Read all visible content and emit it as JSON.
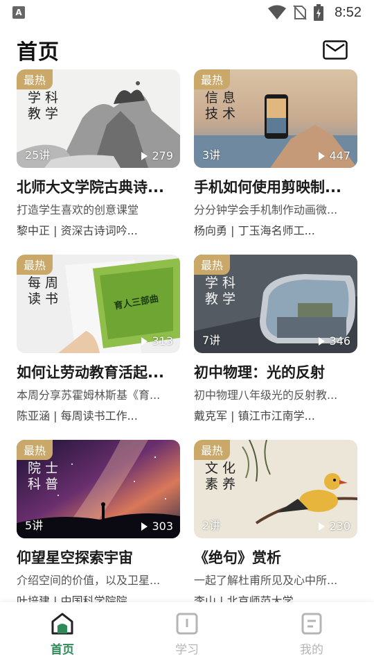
{
  "status_bar": {
    "time": "8:52",
    "app_letter": "A"
  },
  "header": {
    "title": "首页"
  },
  "cards": [
    {
      "badge": "最热",
      "thumb_title": "学科\n教学",
      "lessons": "25讲",
      "plays": "279",
      "title": "北师大文学院古典诗...",
      "desc": "打造学生喜欢的创意课堂",
      "author": "黎中正 | 资深古诗词吟..."
    },
    {
      "badge": "最热",
      "thumb_title": "信息\n技术",
      "lessons": "3讲",
      "plays": "447",
      "title": "手机如何使用剪映制...",
      "desc": "分分钟学会手机制作动画微...",
      "author": "杨向勇 | 丁玉海名师工..."
    },
    {
      "badge": "最热",
      "thumb_title": "每周\n读书",
      "lessons": "",
      "plays": "313",
      "title": "如何让劳动教育活起...",
      "desc": "本周分享苏霍姆林斯基《育...",
      "author": "陈亚涵 | 每周读书工作..."
    },
    {
      "badge": "最热",
      "thumb_title": "学科\n教学",
      "lessons": "7讲",
      "plays": "346",
      "title": "初中物理：光的反射",
      "desc": "初中物理八年级光的反射教...",
      "author": "戴克军 | 镇江市江南学..."
    },
    {
      "badge": "最热",
      "thumb_title": "院士\n科普",
      "lessons": "5讲",
      "plays": "303",
      "title": "仰望星空探索宇宙",
      "desc": "介绍空间的价值，以及卫星...",
      "author": "叶培建 | 中国科学院院..."
    },
    {
      "badge": "最热",
      "thumb_title": "文化\n素养",
      "lessons": "2讲",
      "plays": "230",
      "title": "《绝句》赏析",
      "desc": "一起了解杜甫所见及心中所...",
      "author": "李山 | 北京师范大学..."
    }
  ],
  "book_cover_title": "育人三部曲",
  "tabs": [
    {
      "label": "首页",
      "icon": "home-icon",
      "active": true
    },
    {
      "label": "学习",
      "icon": "book-icon",
      "active": false
    },
    {
      "label": "我的",
      "icon": "profile-doc-icon",
      "active": false
    }
  ],
  "colors": {
    "accent": "#2e8b57",
    "badge": "#c9a86a",
    "inactive": "#b5b5b5"
  }
}
